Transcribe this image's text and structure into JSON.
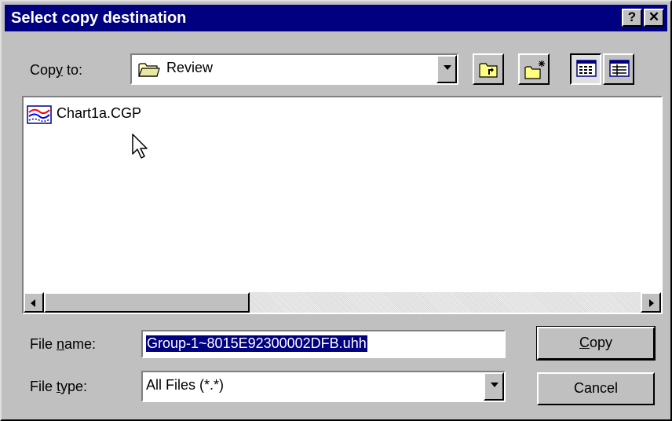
{
  "dialog": {
    "title": "Select copy destination",
    "help_label": "?",
    "close_label": "✕"
  },
  "copy_to": {
    "label_before": "Cop",
    "label_underlined": "y",
    "label_after": " to:",
    "selected_folder": "Review",
    "icons": [
      "up-one-level-icon",
      "new-folder-icon",
      "list-view-icon",
      "details-view-icon"
    ]
  },
  "files": [
    {
      "name": "Chart1a.CGP",
      "icon": "chart-file-icon"
    }
  ],
  "file_name": {
    "label_before": "File ",
    "label_underlined": "n",
    "label_after": "ame:",
    "value": "Group-1~8015E92300002DFB.uhh"
  },
  "file_type": {
    "label_before": "File ",
    "label_underlined": "t",
    "label_after": "ype:",
    "selected": "All Files (*.*)"
  },
  "buttons": {
    "copy_underlined": "C",
    "copy_rest": "opy",
    "cancel": "Cancel"
  },
  "colors": {
    "titlebar": "#000080",
    "face": "#c0c0c0",
    "selection": "#000080"
  }
}
